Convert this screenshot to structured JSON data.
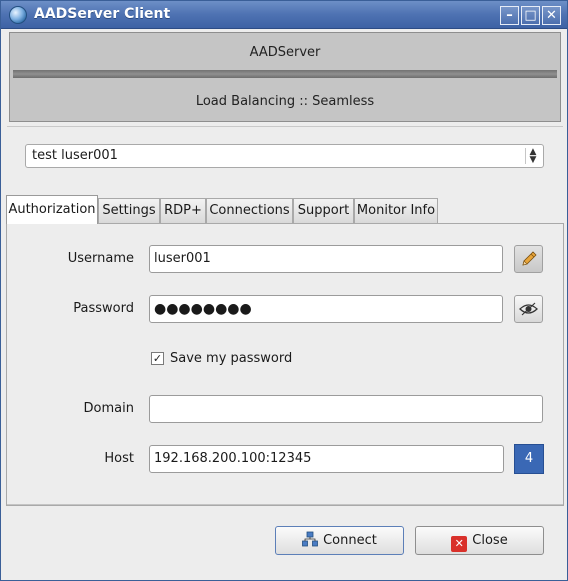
{
  "window": {
    "title": "AADServer Client"
  },
  "banner": {
    "line1": "AADServer",
    "line2": "Load Balancing :: Seamless"
  },
  "profile": {
    "selected": "test luser001"
  },
  "tabs": [
    {
      "label": "Authorization",
      "active": true
    },
    {
      "label": "Settings"
    },
    {
      "label": "RDP+"
    },
    {
      "label": "Connections"
    },
    {
      "label": "Support"
    },
    {
      "label": "Monitor Info"
    }
  ],
  "form": {
    "username_label": "Username",
    "username_value": "luser001",
    "password_label": "Password",
    "password_mask": "●●●●●●●●",
    "save_password_label": "Save my password",
    "save_password_checked": true,
    "domain_label": "Domain",
    "domain_value": "",
    "host_label": "Host",
    "host_value": "192.168.200.100:12345",
    "host_badge": "4"
  },
  "buttons": {
    "connect_label": "Connect",
    "close_label": "Close"
  },
  "icons": {
    "app": "app-globe-icon",
    "edit": "pencil-icon",
    "reveal": "eye-icon",
    "connect": "network-icon",
    "close": "close-icon"
  },
  "colors": {
    "title_bar": "#4e72b2",
    "badge": "#3a68b5",
    "close_icon": "#d9312b"
  }
}
